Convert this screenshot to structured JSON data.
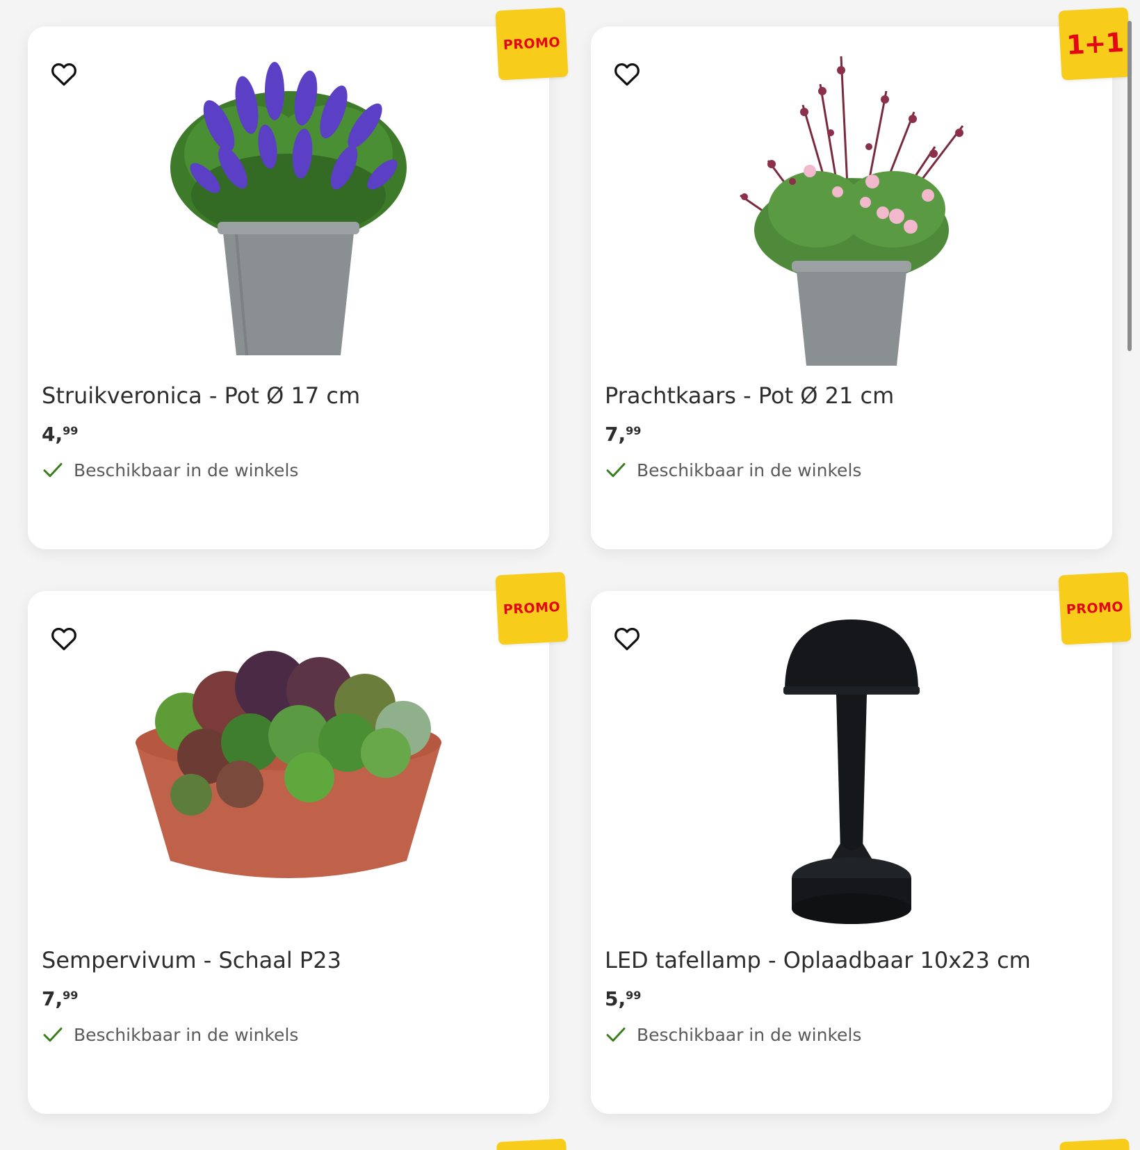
{
  "colors": {
    "badge_background": "#f7cc1b",
    "badge_text": "#e30613",
    "check": "#3a7d1f",
    "card_background": "#ffffff",
    "page_background": "#f4f4f4"
  },
  "products": [
    {
      "title": "Struikveronica - Pot Ø 17 cm",
      "price_main": "4",
      "price_sep": ",",
      "price_cents": "99",
      "availability": "Beschikbaar in de winkels",
      "badge": "PROMO",
      "image_icon": "purple-flower-pot-image"
    },
    {
      "title": "Prachtkaars - Pot Ø 21 cm",
      "price_main": "7",
      "price_sep": ",",
      "price_cents": "99",
      "availability": "Beschikbaar in de winkels",
      "badge": "1+1",
      "image_icon": "pink-flower-pot-image"
    },
    {
      "title": "Sempervivum - Schaal P23",
      "price_main": "7",
      "price_sep": ",",
      "price_cents": "99",
      "availability": "Beschikbaar in de winkels",
      "badge": "PROMO",
      "image_icon": "succulent-bowl-image"
    },
    {
      "title": "LED tafellamp - Oplaadbaar 10x23 cm",
      "price_main": "5",
      "price_sep": ",",
      "price_cents": "99",
      "availability": "Beschikbaar in de winkels",
      "badge": "PROMO",
      "image_icon": "table-lamp-image"
    }
  ]
}
